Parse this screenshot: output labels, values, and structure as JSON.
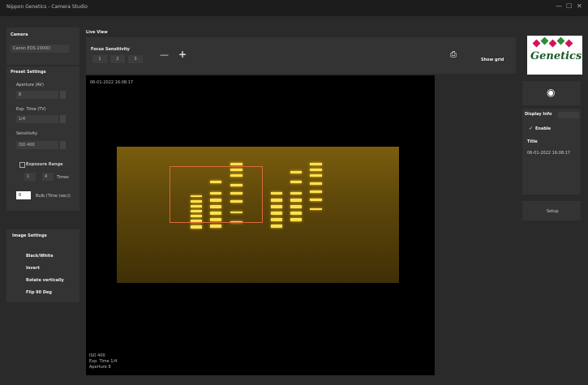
{
  "window": {
    "title": "Nippon Genetics - Camera Studio",
    "controls": [
      "—",
      "☐",
      "✕"
    ]
  },
  "camera": {
    "header": "Camera",
    "model": "Canon EOS 2000D"
  },
  "preset": {
    "header": "Preset Settings",
    "aperture_label": "Aperture (AV)",
    "aperture_value": "8",
    "exp_label": "Exp. Time (TV)",
    "exp_value": "1/4",
    "sensitivity_label": "Sensitivity",
    "sensitivity_value": "ISO 400",
    "exposure_range_label": "Exposure Range",
    "range_from": "1",
    "range_to": "4",
    "range_unit": "Times",
    "bulb_value": "0",
    "bulb_label": "Bulb (Time (sec))"
  },
  "image_settings": {
    "header": "Image Settings",
    "items": [
      "Black/White",
      "Invert",
      "Rotate vertically",
      "Flip 90 Deg"
    ]
  },
  "live_view": {
    "header": "Live View",
    "focus_label": "Focus Sensitivity",
    "focus_options": [
      "1",
      "2",
      "3"
    ],
    "zoom_minus": "—",
    "zoom_plus": "+",
    "show_grid": "Show grid",
    "timestamp": "06-01-2022 16:08:17",
    "overlay_lines": [
      "ISO 400",
      "Exp. Time 1/4",
      "Aperture 8"
    ]
  },
  "right": {
    "logo_text": "Genetics",
    "display_info_label": "Display Info",
    "enable_label": "Enable",
    "title_label": "Title",
    "title_value": "06-01-2022 16:08:17",
    "setup_label": "Setup"
  },
  "colors": {
    "roi": "#d86a3a",
    "band": "#ffe24d",
    "gel": "#6b520c"
  }
}
